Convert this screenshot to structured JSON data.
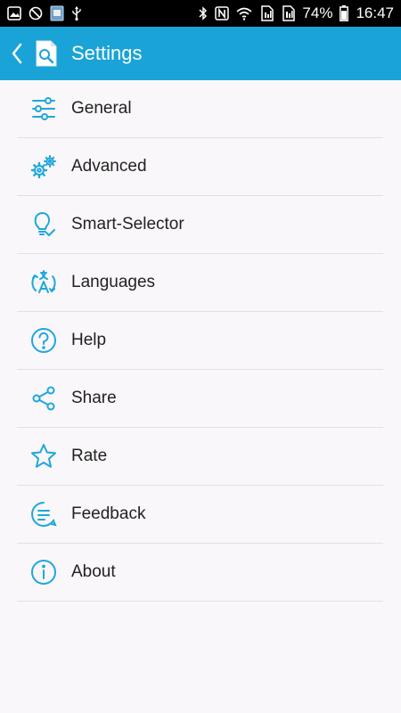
{
  "status_bar": {
    "battery": "74%",
    "time": "16:47",
    "left_icons": [
      "gallery-icon",
      "blocked-icon",
      "app-thumbnail-icon",
      "usb-icon"
    ],
    "right_icons": [
      "bluetooth-icon",
      "nfc-icon",
      "wifi-icon",
      "sim1-icon",
      "sim2-icon",
      "battery-icon"
    ]
  },
  "toolbar": {
    "title": "Settings",
    "back_icon": "back-arrow-icon",
    "logo_icon": "app-logo-icon"
  },
  "menu": {
    "items": [
      {
        "label": "General",
        "icon": "sliders-icon"
      },
      {
        "label": "Advanced",
        "icon": "gears-icon"
      },
      {
        "label": "Smart-Selector",
        "icon": "lightbulb-check-icon"
      },
      {
        "label": "Languages",
        "icon": "translate-icon"
      },
      {
        "label": "Help",
        "icon": "help-icon"
      },
      {
        "label": "Share",
        "icon": "share-icon"
      },
      {
        "label": "Rate",
        "icon": "star-icon"
      },
      {
        "label": "Feedback",
        "icon": "feedback-icon"
      },
      {
        "label": "About",
        "icon": "info-icon"
      }
    ]
  },
  "colors": {
    "toolbar": "#1aa3d6",
    "icon_accent": "#1ea7dc",
    "background": "#f9f7f9",
    "divider": "#e2e0e2"
  }
}
